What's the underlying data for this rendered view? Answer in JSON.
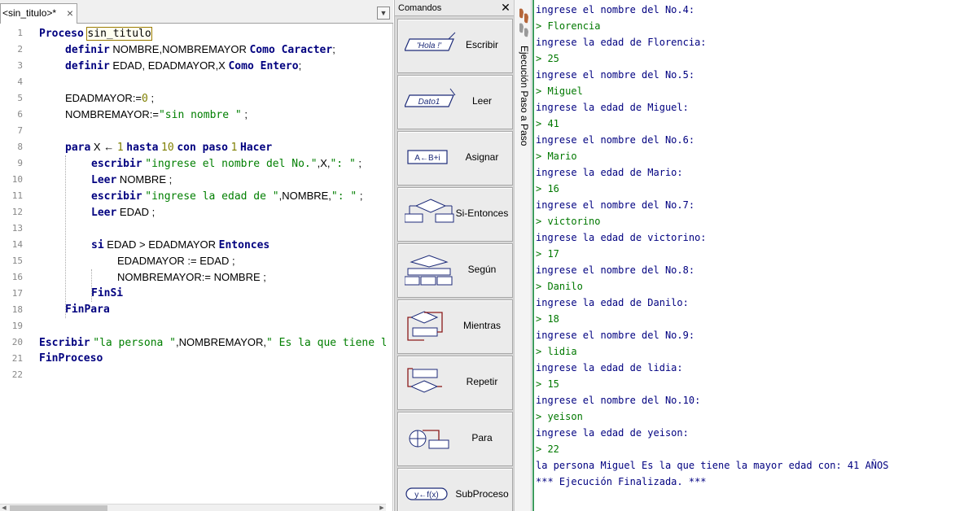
{
  "editor": {
    "tab_title": "<sin_titulo>*",
    "close_glyph": "×",
    "dropdown_glyph": "▼",
    "lines": [
      {
        "n": "1",
        "parts": [
          {
            "t": "kw",
            "v": "Proceso"
          },
          {
            "t": "id",
            "v": " "
          },
          {
            "t": "nm",
            "v": "sin_titulo"
          }
        ]
      },
      {
        "n": "2",
        "parts": [
          {
            "t": "kw",
            "v": "definir"
          },
          {
            "t": "id",
            "v": " NOMBRE,NOMBREMAYOR "
          },
          {
            "t": "kw",
            "v": "Como Caracter"
          },
          {
            "t": "id",
            "v": ";"
          }
        ]
      },
      {
        "n": "3",
        "parts": [
          {
            "t": "kw",
            "v": "definir"
          },
          {
            "t": "id",
            "v": " EDAD, EDADMAYOR,X "
          },
          {
            "t": "kw",
            "v": "Como Entero"
          },
          {
            "t": "id",
            "v": ";"
          }
        ]
      },
      {
        "n": "4",
        "parts": []
      },
      {
        "n": "5",
        "parts": [
          {
            "t": "id",
            "v": "EDADMAYOR:="
          },
          {
            "t": "num",
            "v": "0"
          },
          {
            "t": "id",
            "v": " ;"
          }
        ]
      },
      {
        "n": "6",
        "parts": [
          {
            "t": "id",
            "v": "NOMBREMAYOR:="
          },
          {
            "t": "str",
            "v": "\"sin nombre \""
          },
          {
            "t": "id",
            "v": " ;"
          }
        ]
      },
      {
        "n": "7",
        "parts": []
      },
      {
        "n": "8",
        "parts": [
          {
            "t": "kw",
            "v": "para"
          },
          {
            "t": "id",
            "v": " X ← "
          },
          {
            "t": "num",
            "v": "1"
          },
          {
            "t": "id",
            "v": " "
          },
          {
            "t": "kw",
            "v": "hasta"
          },
          {
            "t": "id",
            "v": " "
          },
          {
            "t": "num",
            "v": "10"
          },
          {
            "t": "id",
            "v": " "
          },
          {
            "t": "kw",
            "v": "con paso"
          },
          {
            "t": "id",
            "v": " "
          },
          {
            "t": "num",
            "v": "1"
          },
          {
            "t": "id",
            "v": " "
          },
          {
            "t": "kw",
            "v": "Hacer"
          }
        ]
      },
      {
        "n": "9",
        "parts": [
          {
            "t": "kw",
            "v": "escribir"
          },
          {
            "t": "id",
            "v": " "
          },
          {
            "t": "str",
            "v": "\"ingrese el nombre del No.\""
          },
          {
            "t": "id",
            "v": ",X,"
          },
          {
            "t": "str",
            "v": "\": \""
          },
          {
            "t": "id",
            "v": " ;"
          }
        ]
      },
      {
        "n": "10",
        "parts": [
          {
            "t": "kw",
            "v": "Leer"
          },
          {
            "t": "id",
            "v": " NOMBRE ;"
          }
        ]
      },
      {
        "n": "11",
        "parts": [
          {
            "t": "kw",
            "v": "escribir"
          },
          {
            "t": "id",
            "v": " "
          },
          {
            "t": "str",
            "v": "\"ingrese la edad de \""
          },
          {
            "t": "id",
            "v": ",NOMBRE,"
          },
          {
            "t": "str",
            "v": "\": \""
          },
          {
            "t": "id",
            "v": " ;"
          }
        ]
      },
      {
        "n": "12",
        "parts": [
          {
            "t": "kw",
            "v": "Leer"
          },
          {
            "t": "id",
            "v": " EDAD ;"
          }
        ]
      },
      {
        "n": "13",
        "parts": []
      },
      {
        "n": "14",
        "parts": [
          {
            "t": "kw",
            "v": "si"
          },
          {
            "t": "id",
            "v": " EDAD > EDADMAYOR "
          },
          {
            "t": "kw",
            "v": "Entonces"
          }
        ]
      },
      {
        "n": "15",
        "parts": [
          {
            "t": "id",
            "v": "EDADMAYOR := EDAD ;"
          }
        ]
      },
      {
        "n": "16",
        "parts": [
          {
            "t": "id",
            "v": "NOMBREMAYOR:= NOMBRE ;"
          }
        ]
      },
      {
        "n": "17",
        "parts": [
          {
            "t": "kw",
            "v": "FinSi"
          }
        ]
      },
      {
        "n": "18",
        "parts": [
          {
            "t": "kw",
            "v": "FinPara"
          }
        ]
      },
      {
        "n": "19",
        "parts": []
      },
      {
        "n": "20",
        "parts": [
          {
            "t": "kw",
            "v": "Escribir"
          },
          {
            "t": "id",
            "v": " "
          },
          {
            "t": "str",
            "v": "\"la persona \""
          },
          {
            "t": "id",
            "v": ",NOMBREMAYOR,"
          },
          {
            "t": "str",
            "v": "\" Es la que tiene la mayor"
          }
        ]
      },
      {
        "n": "21",
        "parts": [
          {
            "t": "kw",
            "v": "FinProceso"
          }
        ]
      },
      {
        "n": "22",
        "parts": []
      }
    ]
  },
  "commands": {
    "title": "Comandos",
    "close_glyph": "✕",
    "items": [
      {
        "label": "Escribir",
        "icon": "escribir-icon",
        "icon_text": "'Hola !'"
      },
      {
        "label": "Leer",
        "icon": "leer-icon",
        "icon_text": "Dato1"
      },
      {
        "label": "Asignar",
        "icon": "asignar-icon",
        "icon_text": "A←B+i"
      },
      {
        "label": "Si-Entonces",
        "icon": "si-entonces-icon",
        "icon_text": ""
      },
      {
        "label": "Según",
        "icon": "segun-icon",
        "icon_text": ""
      },
      {
        "label": "Mientras",
        "icon": "mientras-icon",
        "icon_text": ""
      },
      {
        "label": "Repetir",
        "icon": "repetir-icon",
        "icon_text": ""
      },
      {
        "label": "Para",
        "icon": "para-icon",
        "icon_text": ""
      },
      {
        "label": "SubProceso",
        "icon": "subproceso-icon",
        "icon_text": "y←f(x)"
      }
    ]
  },
  "strip": {
    "label": "Ejecución Paso a Paso",
    "icon": "footsteps-icon"
  },
  "console": {
    "lines": [
      {
        "type": "out",
        "text": "ingrese el nombre del No.4:"
      },
      {
        "type": "in",
        "text": "> Florencia"
      },
      {
        "type": "out",
        "text": "ingrese la edad de Florencia:"
      },
      {
        "type": "in",
        "text": "> 25"
      },
      {
        "type": "out",
        "text": "ingrese el nombre del No.5:"
      },
      {
        "type": "in",
        "text": "> Miguel"
      },
      {
        "type": "out",
        "text": "ingrese la edad de Miguel:"
      },
      {
        "type": "in",
        "text": "> 41"
      },
      {
        "type": "out",
        "text": "ingrese el nombre del No.6:"
      },
      {
        "type": "in",
        "text": "> Mario"
      },
      {
        "type": "out",
        "text": "ingrese la edad de Mario:"
      },
      {
        "type": "in",
        "text": "> 16"
      },
      {
        "type": "out",
        "text": "ingrese el nombre del No.7:"
      },
      {
        "type": "in",
        "text": "> victorino"
      },
      {
        "type": "out",
        "text": "ingrese la edad de victorino:"
      },
      {
        "type": "in",
        "text": "> 17"
      },
      {
        "type": "out",
        "text": "ingrese el nombre del No.8:"
      },
      {
        "type": "in",
        "text": "> Danilo"
      },
      {
        "type": "out",
        "text": "ingrese la edad de Danilo:"
      },
      {
        "type": "in",
        "text": "> 18"
      },
      {
        "type": "out",
        "text": "ingrese el nombre del No.9:"
      },
      {
        "type": "in",
        "text": "> lidia"
      },
      {
        "type": "out",
        "text": "ingrese la edad de lidia:"
      },
      {
        "type": "in",
        "text": "> 15"
      },
      {
        "type": "out",
        "text": "ingrese el nombre del No.10:"
      },
      {
        "type": "in",
        "text": "> yeison"
      },
      {
        "type": "out",
        "text": "ingrese la edad de yeison:"
      },
      {
        "type": "in",
        "text": "> 22"
      },
      {
        "type": "out",
        "text": "la persona Miguel Es la que tiene la mayor edad con: 41 AÑOS"
      },
      {
        "type": "end",
        "text": "*** Ejecución Finalizada. ***"
      }
    ]
  },
  "colors": {
    "keyword": "#00007f",
    "string": "#007f00",
    "number": "#7f7f00",
    "console_output": "#000080",
    "console_input": "#007800",
    "console_border": "#3d9b5d"
  }
}
